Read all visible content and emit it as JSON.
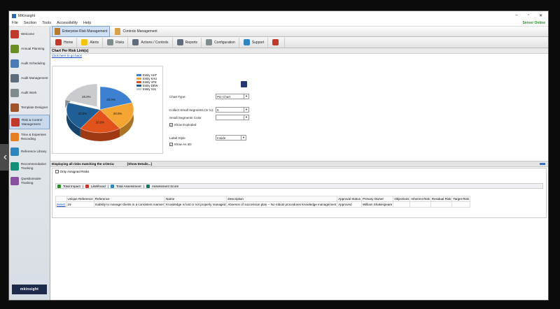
{
  "window": {
    "title": "MKinsight",
    "min": "–",
    "max": "▫",
    "close": "✕"
  },
  "menu": {
    "items": [
      "File",
      "Section",
      "Tools",
      "Accessibility",
      "Help"
    ],
    "server_status": "Server Online"
  },
  "sidebar": {
    "items": [
      {
        "label": "Welcome",
        "icon": "welcome-icon",
        "color": "#c0392b"
      },
      {
        "label": "Annual Planning",
        "icon": "calendar-icon",
        "color": "#6b8e23"
      },
      {
        "label": "Audit Scheduling",
        "icon": "scheduling-icon",
        "color": "#4a7bb7"
      },
      {
        "label": "Audit Management",
        "icon": "management-icon",
        "color": "#5d6d7e"
      },
      {
        "label": "Audit Work",
        "icon": "work-icon",
        "color": "#7f8c8d"
      },
      {
        "label": "Template Designer",
        "icon": "template-icon",
        "color": "#a0522d"
      },
      {
        "label": "Risk & Control Management",
        "icon": "risk-icon",
        "color": "#c0392b",
        "active": true
      },
      {
        "label": "Time & Expenses Recording",
        "icon": "clock-icon",
        "color": "#e67e22"
      },
      {
        "label": "Reference Library",
        "icon": "library-icon",
        "color": "#2e86c1"
      },
      {
        "label": "Recommendation Tracking",
        "icon": "recommendation-icon",
        "color": "#148f77"
      },
      {
        "label": "Questionnaire Tracking",
        "icon": "questionnaire-icon",
        "color": "#884ea0"
      }
    ],
    "brand": "mkinsight"
  },
  "module_tabs": [
    {
      "label": "Enterprise Risk Management",
      "active": true
    },
    {
      "label": "Controls Management",
      "active": false
    }
  ],
  "nav": [
    {
      "label": "Home",
      "icon": "home-icon",
      "color": "#c0392b"
    },
    {
      "label": "Alerts",
      "icon": "alert-icon",
      "color": "#f1c40f"
    },
    {
      "label": "Risks",
      "icon": "risks-icon",
      "color": "#7f8c8d"
    },
    {
      "label": "Actions / Controls",
      "icon": "actions-icon",
      "color": "#5d6d7e"
    },
    {
      "label": "Reports",
      "icon": "reports-icon",
      "color": "#5d6d7e"
    },
    {
      "label": "Configuration",
      "icon": "configuration-icon",
      "color": "#7f8c8d"
    },
    {
      "label": "Support",
      "icon": "support-icon",
      "color": "#2e86c1"
    },
    {
      "label": "",
      "icon": "exit-icon",
      "color": "#c0392b"
    }
  ],
  "chart_section": {
    "header": "Chart Per Risk Link(s)",
    "back_link": "Click here to go back"
  },
  "chart_data": {
    "type": "pie",
    "categories": [
      "Entity HHT",
      "Entity KAU",
      "Entity VFE",
      "Entity DEW",
      "Entity X2s"
    ],
    "values": [
      20.0,
      20.0,
      20.0,
      20.0,
      20.0
    ],
    "labels": [
      "20.0%",
      "20.0%",
      "20.0%",
      "20.0%",
      "20.0%"
    ],
    "colors": [
      "#3d7fd0",
      "#f5a531",
      "#e2521d",
      "#1f5f96",
      "#c9cbcf"
    ],
    "exploded": "Entity X2s",
    "title": "",
    "legend": "top-right"
  },
  "chart_options": {
    "chart_type_label": "Chart Type:",
    "chart_type_value": "Pie Chart",
    "collect_label": "Collect Small Segments (in %):",
    "collect_value": "5",
    "small_color_label": "Small Segments Color",
    "small_color_value": "",
    "show_exploded_label": "Show Exploded",
    "label_style_label": "Label Style",
    "label_style_value": "Inside",
    "show_3d_label": "Show As 3D"
  },
  "risks": {
    "header": "Displaying all risks matching the criteria:",
    "show_details": "[Show Details...]",
    "only_assigned": "Only Assigned Risks",
    "filters": [
      "Total Impact",
      "Likelihood",
      "Total Assessment",
      "Assessment Score"
    ],
    "columns": [
      "",
      "Unique Reference",
      "Reference",
      "Name",
      "Description",
      "Approval Status",
      "Primary Owner",
      "Objectives",
      "Inherent Risk",
      "Residual Risk",
      "Target Risk"
    ],
    "rows": [
      [
        "Select",
        "19",
        "Inability to manage clients in a consistent manner",
        "Knowledge is lost or not properly managed",
        "Absence of succession plan -- No robust procedures knowledge management",
        "Approved",
        "William Shakespeare",
        "",
        "",
        "",
        ""
      ]
    ]
  }
}
